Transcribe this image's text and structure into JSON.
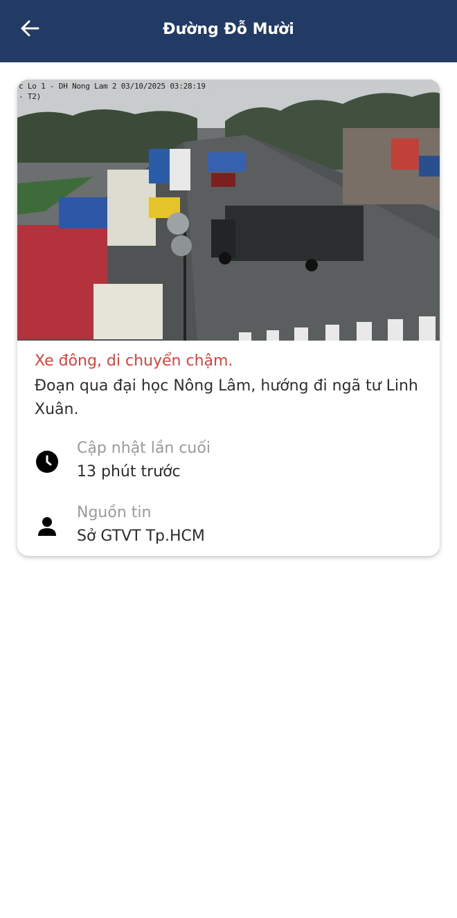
{
  "appbar": {
    "title": "Đường Đỗ Mười",
    "back_icon": "arrow-left-icon"
  },
  "camera": {
    "overlay_text": "c Lo 1 - DH Nong Lam 2    03/10/2025  03:28:19",
    "overlay_text_line2": "- T2)"
  },
  "report": {
    "status": "Xe đông, di chuyển chậm.",
    "description": "Đoạn qua đại học Nông Lâm, hướng đi ngã tư Linh Xuân."
  },
  "updated": {
    "icon": "clock-icon",
    "label": "Cập nhật lần cuối",
    "value": "13 phút trước"
  },
  "source": {
    "icon": "person-icon",
    "label": "Nguồn tin",
    "value": "Sở GTVT Tp.HCM"
  },
  "colors": {
    "appbar": "#213b64",
    "status": "#d9433a"
  }
}
